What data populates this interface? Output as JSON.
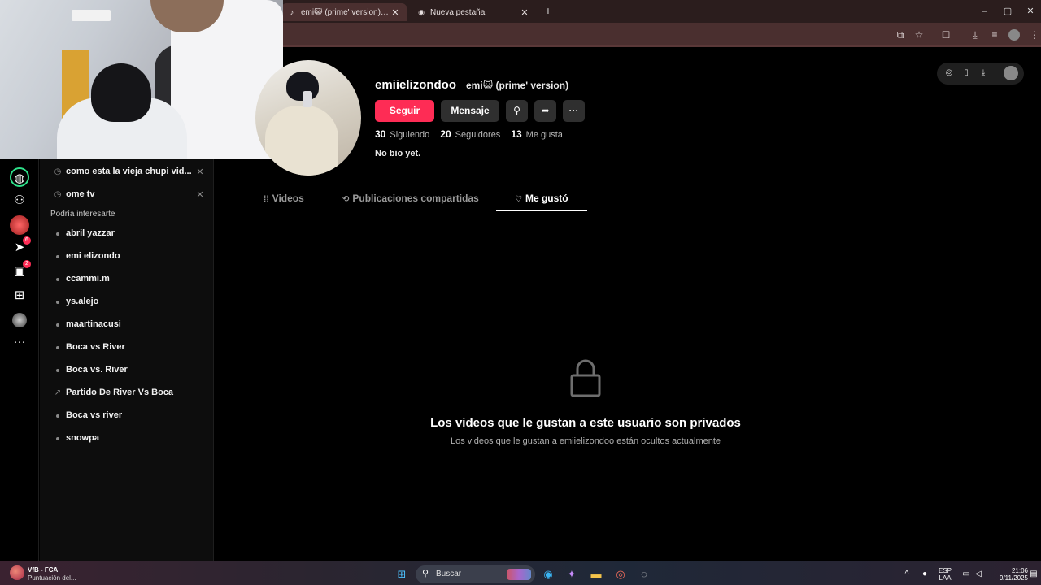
{
  "browser": {
    "tabs": [
      {
        "title": "emi😺 (prime' version) (@emii",
        "active": true
      },
      {
        "title": "Nueva pestaña",
        "active": false
      }
    ],
    "new_tab": "+",
    "window_controls": {
      "minimize": "–",
      "maximize": "▢",
      "close": "✕"
    }
  },
  "sidebar": {
    "recent_searches": [
      {
        "text": "como esta la vieja chupi vid..."
      },
      {
        "text": "ome tv"
      }
    ],
    "suggest_heading": "Podría interesarte",
    "suggestions": [
      {
        "text": "abril yazzar"
      },
      {
        "text": "emi elizondo"
      },
      {
        "text": "ccammi.m"
      },
      {
        "text": "ys.alejo"
      },
      {
        "text": "maartinacusi"
      },
      {
        "text": "Boca vs River"
      },
      {
        "text": "Boca vs. River"
      },
      {
        "text": "Partido De River Vs Boca",
        "trending": true
      },
      {
        "text": "Boca vs river"
      },
      {
        "text": "snowpa"
      }
    ],
    "badges": {
      "messages": "6",
      "inbox": "2"
    }
  },
  "profile": {
    "username": "emiielizondoo",
    "nickname": "emi😺 (prime' version)",
    "follow_label": "Seguir",
    "message_label": "Mensaje",
    "more_label": "···",
    "stats": [
      {
        "num": "30",
        "label": "Siguiendo"
      },
      {
        "num": "20",
        "label": "Seguidores"
      },
      {
        "num": "13",
        "label": "Me gusta"
      }
    ],
    "bio": "No bio yet."
  },
  "tabs": {
    "videos": "Videos",
    "reposts": "Publicaciones compartidas",
    "liked": "Me gustó"
  },
  "private": {
    "title": "Los videos que le gustan a este usuario son privados",
    "subtitle": "Los videos que le gustan a emiielizondoo están ocultos actualmente"
  },
  "taskbar": {
    "weather_title": "VfB - FCA",
    "weather_sub": "Puntuación del...",
    "search_placeholder": "Buscar",
    "lang_top": "ESP",
    "lang_bottom": "LAA",
    "time": "21:06",
    "date": "9/11/2025"
  },
  "colors": {
    "accent": "#fe2c55",
    "chrome": "#4a2f2f",
    "background": "#000000"
  }
}
